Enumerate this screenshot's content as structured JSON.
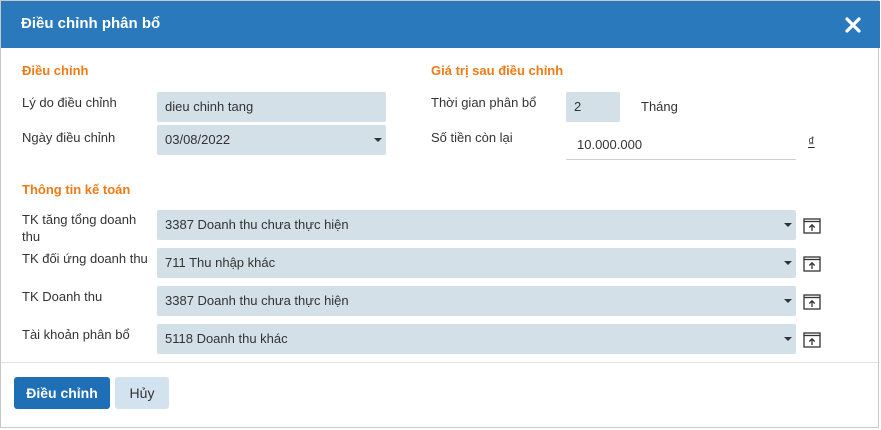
{
  "dialog": {
    "title": "Điều chỉnh phân bổ",
    "close_icon": "close-x-icon"
  },
  "adjust_section": {
    "title": "Điều chỉnh",
    "reason_label": "Lý do điều chỉnh",
    "reason_value": "dieu chinh tang",
    "date_label": "Ngày điều chỉnh",
    "date_value": "03/08/2022"
  },
  "after_section": {
    "title": "Giá trị sau điều chỉnh",
    "period_label": "Thời gian phân bổ",
    "period_value": "2",
    "period_unit": "Tháng",
    "remaining_label": "Số tiền còn lại",
    "remaining_value": "10.000.000",
    "currency_symbol": "₫"
  },
  "accounting_section": {
    "title": "Thông tin kế toán",
    "rows": [
      {
        "label": "TK tăng tổng doanh thu",
        "value": "3387 Doanh thu chưa thực hiện"
      },
      {
        "label": "TK đối ứng doanh thu",
        "value": "711 Thu nhập khác"
      },
      {
        "label": "TK Doanh thu",
        "value": "3387 Doanh thu chưa thực hiện"
      },
      {
        "label": "Tài khoản phân bổ",
        "value": "5118 Doanh thu khác"
      }
    ],
    "row_icon": "open-in-new-window-icon"
  },
  "footer": {
    "confirm_label": "Điều chỉnh",
    "cancel_label": "Hủy"
  },
  "colors": {
    "header_bg": "#2b79bd",
    "section_title": "#f07a16",
    "field_bg": "#d3e0e7",
    "primary_button": "#1e6fb5",
    "secondary_button": "#d3e2ef"
  }
}
